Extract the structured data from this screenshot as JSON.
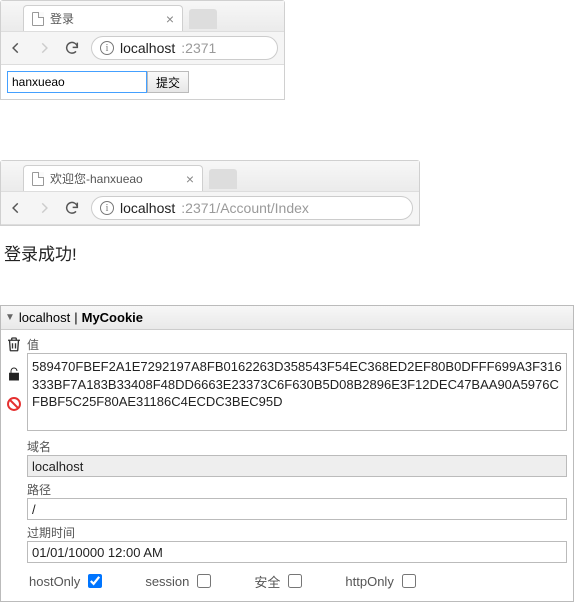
{
  "browser1": {
    "tab_title": "登录",
    "url_host": "localhost",
    "url_rest": ":2371",
    "username_value": "hanxueao",
    "submit_label": "提交"
  },
  "browser2": {
    "tab_title": "欢迎您-hanxueao",
    "url_host": "localhost",
    "url_rest": ":2371/Account/Index",
    "success_text": "登录成功!"
  },
  "devtools": {
    "header_host": "localhost",
    "header_sep": " | ",
    "header_cookie": "MyCookie",
    "labels": {
      "value": "值",
      "domain": "域名",
      "path": "路径",
      "expires": "过期时间",
      "hostOnly": "hostOnly",
      "session": "session",
      "secure": "安全",
      "httpOnly": "httpOnly"
    },
    "cookie": {
      "value": "589470FBEF2A1E7292197A8FB0162263D358543F54EC368ED2EF80B0DFFF699A3F316333BF7A183B33408F48DD6663E23373C6F630B5D08B2896E3F12DEC47BAA90A5976CFBBF5C25F80AE31186C4ECDC3BEC95D",
      "domain": "localhost",
      "path": "/",
      "expires": "01/01/10000 12:00 AM",
      "hostOnly": true,
      "session": false,
      "secure": false,
      "httpOnly": false
    }
  }
}
